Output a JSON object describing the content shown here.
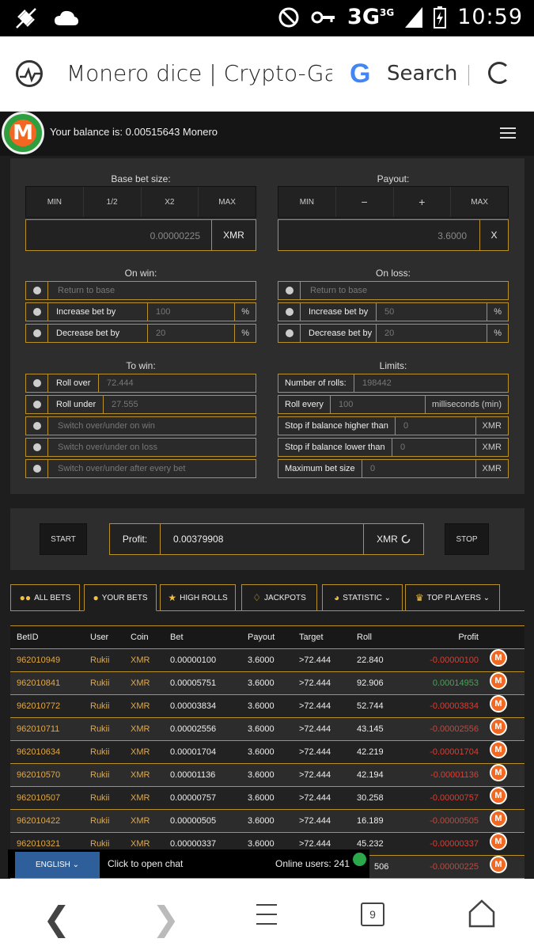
{
  "status": {
    "time": "10:59",
    "network": "3G"
  },
  "browser": {
    "title": "Monero dice | Crypto-Game",
    "search_label": "Search"
  },
  "header": {
    "balance": "Your balance is: 0.00515643 Monero"
  },
  "base_bet": {
    "label": "Base bet size:",
    "buttons": [
      "MIN",
      "1/2",
      "X2",
      "MAX"
    ],
    "value": "0.00000225",
    "unit": "XMR"
  },
  "payout": {
    "label": "Payout:",
    "buttons": [
      "MIN",
      "−",
      "+",
      "MAX"
    ],
    "value": "3.6000",
    "unit": "X"
  },
  "on_win": {
    "label": "On win:",
    "return_placeholder": "Return to base",
    "increase_label": "Increase bet by",
    "increase_value": "100",
    "decrease_label": "Decrease bet by",
    "decrease_value": "20",
    "suffix": "%"
  },
  "on_loss": {
    "label": "On loss:",
    "return_placeholder": "Return to base",
    "increase_label": "Increase bet by",
    "increase_value": "50",
    "decrease_label": "Decrease bet by",
    "decrease_value": "20",
    "suffix": "%"
  },
  "to_win": {
    "label": "To win:",
    "roll_over_label": "Roll over",
    "roll_over_value": "72.444",
    "roll_under_label": "Roll under",
    "roll_under_value": "27.555",
    "switch_win": "Switch over/under on win",
    "switch_loss": "Switch over/under on loss",
    "switch_every": "Switch over/under after every bet"
  },
  "limits": {
    "label": "Limits:",
    "rolls_label": "Number of rolls:",
    "rolls_value": "198442",
    "every_label": "Roll every",
    "every_value": "100",
    "every_unit": "milliseconds (min)",
    "higher_label": "Stop if balance higher than",
    "higher_value": "0",
    "lower_label": "Stop if balance lower than",
    "lower_value": "0",
    "max_label": "Maximum bet size",
    "max_value": "0",
    "unit": "XMR"
  },
  "controls": {
    "start": "START",
    "stop": "STOP",
    "profit_label": "Profit:",
    "profit_value": "0.00379908",
    "profit_unit": "XMR"
  },
  "tabs": [
    "ALL BETS",
    "YOUR BETS",
    "HIGH ROLLS",
    "JACKPOTS",
    "STATISTIC ⌄",
    "TOP PLAYERS ⌄"
  ],
  "table": {
    "headers": [
      "BetID",
      "User",
      "Coin",
      "Bet",
      "Payout",
      "Target",
      "Roll",
      "Profit"
    ],
    "rows": [
      [
        "962010949",
        "Rukii",
        "XMR",
        "0.00000100",
        "3.6000",
        ">72.444",
        "22.840",
        "-0.00000100"
      ],
      [
        "962010841",
        "Rukii",
        "XMR",
        "0.00005751",
        "3.6000",
        ">72.444",
        "92.906",
        "0.00014953"
      ],
      [
        "962010772",
        "Rukii",
        "XMR",
        "0.00003834",
        "3.6000",
        ">72.444",
        "52.744",
        "-0.00003834"
      ],
      [
        "962010711",
        "Rukii",
        "XMR",
        "0.00002556",
        "3.6000",
        ">72.444",
        "43.145",
        "-0.00002556"
      ],
      [
        "962010634",
        "Rukii",
        "XMR",
        "0.00001704",
        "3.6000",
        ">72.444",
        "42.219",
        "-0.00001704"
      ],
      [
        "962010570",
        "Rukii",
        "XMR",
        "0.00001136",
        "3.6000",
        ">72.444",
        "42.194",
        "-0.00001136"
      ],
      [
        "962010507",
        "Rukii",
        "XMR",
        "0.00000757",
        "3.6000",
        ">72.444",
        "30.258",
        "-0.00000757"
      ],
      [
        "962010422",
        "Rukii",
        "XMR",
        "0.00000505",
        "3.6000",
        ">72.444",
        "16.189",
        "-0.00000505"
      ],
      [
        "962010321",
        "Rukii",
        "XMR",
        "0.00000337",
        "3.6000",
        ">72.444",
        "45.232",
        "-0.00000337"
      ],
      [
        "",
        "",
        "",
        "",
        "",
        "",
        "506",
        "-0.00000225"
      ]
    ]
  },
  "chat": {
    "language": "ENGLISH ⌄",
    "open_chat": "Click to open chat",
    "online": "Online users: 241"
  },
  "nav": {
    "tab_count": "9"
  }
}
